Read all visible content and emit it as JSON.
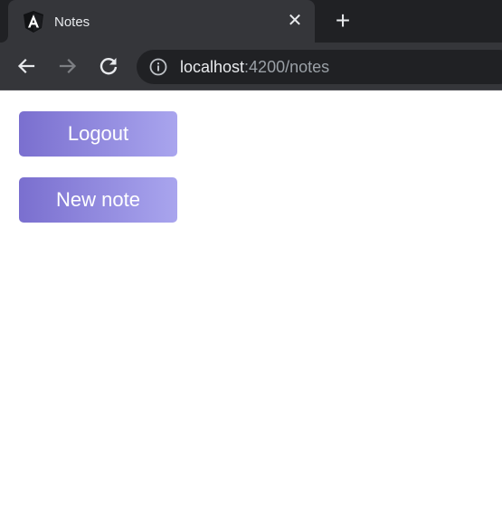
{
  "browser": {
    "tab": {
      "title": "Notes",
      "icon": "angular-logo-icon",
      "close_glyph": "✕"
    },
    "new_tab_glyph": "+",
    "nav": {
      "back": "arrow-left-icon",
      "forward": "arrow-right-icon",
      "reload": "reload-icon"
    },
    "address": {
      "host": "localhost",
      "rest": ":4200/notes",
      "security_icon": "info-icon"
    }
  },
  "page": {
    "buttons": {
      "logout": "Logout",
      "new_note": "New note"
    },
    "colors": {
      "button_gradient_start": "#7a6fcf",
      "button_gradient_end": "#a9a5ee"
    }
  }
}
